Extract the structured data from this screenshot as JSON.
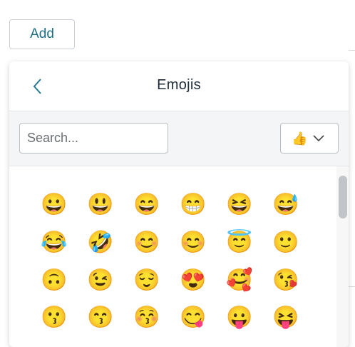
{
  "add_button": {
    "label": "Add"
  },
  "picker": {
    "title": "Emojis",
    "back_icon": "chevron-left-icon",
    "search": {
      "placeholder": "Search...",
      "value": ""
    },
    "skin_tone": {
      "selected": "👍",
      "dropdown_icon": "chevron-down-icon"
    },
    "emojis": [
      [
        "😀",
        "😃",
        "😄",
        "😁",
        "😆",
        "😅"
      ],
      [
        "😂",
        "🤣",
        "😊",
        "😊",
        "😇",
        "🙂"
      ],
      [
        "🙃",
        "😉",
        "😌",
        "😍",
        "🥰",
        "😘"
      ],
      [
        "😗",
        "😙",
        "😚",
        "😋",
        "😛",
        "😝"
      ]
    ]
  },
  "colors": {
    "accent": "#1f6f86",
    "title": "#1f2d3a",
    "toolbar_bg": "#f4f5f7"
  }
}
